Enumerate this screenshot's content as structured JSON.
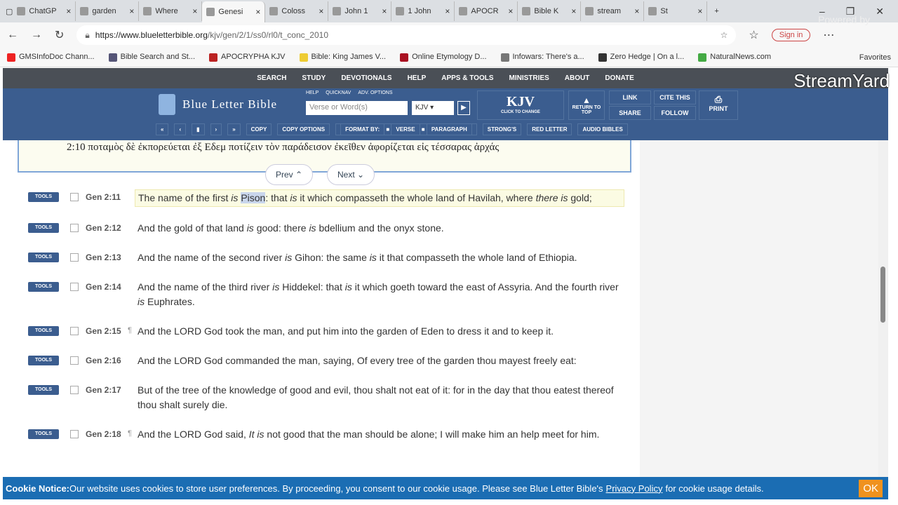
{
  "browser": {
    "tabs": [
      "ChatGP",
      "garden",
      "Where",
      "Genesi",
      "Coloss",
      "John 1",
      "1 John",
      "APOCR",
      "Bible K",
      "stream",
      "St"
    ],
    "active_tab": 3,
    "url_host": "https://www.blueletterbible.org",
    "url_path": "/kjv/gen/2/1/ss0/rl0/t_conc_2010",
    "sign_in": "Sign in",
    "bookmarks": [
      {
        "label": "GMSInfoDoc Chann...",
        "color": "#e22"
      },
      {
        "label": "Bible Search and St...",
        "color": "#557"
      },
      {
        "label": "APOCRYPHA KJV",
        "color": "#b22"
      },
      {
        "label": "Bible: King James V...",
        "color": "#ec3"
      },
      {
        "label": "Online Etymology D...",
        "color": "#a12"
      },
      {
        "label": "Infowars: There's a...",
        "color": "#777"
      },
      {
        "label": "Zero Hedge | On a l...",
        "color": "#333"
      },
      {
        "label": "NaturalNews.com",
        "color": "#4a4"
      }
    ],
    "favorites": "Favorites"
  },
  "overlay": {
    "powered_by": "Powered by",
    "brand": "StreamYard"
  },
  "site": {
    "nav": [
      "SEARCH",
      "STUDY",
      "DEVOTIONALS",
      "HELP",
      "APPS & TOOLS",
      "MINISTRIES",
      "ABOUT",
      "DONATE"
    ],
    "logo": "Blue Letter Bible",
    "search_links": [
      "HELP",
      "QUICKNAV",
      "ADV. OPTIONS"
    ],
    "search_placeholder": "Verse or Word(s)",
    "version_select": "KJV",
    "version_big": "KJV",
    "version_hint": "CLICK TO CHANGE",
    "return_top": "RETURN TO TOP",
    "link": "LINK",
    "share": "SHARE",
    "cite": "CITE THIS",
    "follow": "FOLLOW",
    "print": "PRINT",
    "toolbar": [
      "COPY",
      "COPY OPTIONS",
      "FORMAT BY:",
      "VERSE",
      "PARAGRAPH",
      "STRONG'S",
      "RED LETTER",
      "AUDIO BIBLES"
    ]
  },
  "greek_line": "2:10  ποταμὸς δὲ ἐκπορεύεται ἐξ Εδεμ ποτίζειν τὸν παράδεισον ἐκεῖθεν ἀφορίζεται εἰς τέσσαρας ἀρχάς",
  "prev": "Prev",
  "next": "Next",
  "tools_label": "TOOLS",
  "verses": [
    {
      "ref": "Gen 2:11",
      "pilcrow": false,
      "highlight": true,
      "segments": [
        [
          "The name of the first ",
          ""
        ],
        [
          "is",
          "i"
        ],
        [
          " ",
          ""
        ],
        [
          "Pison",
          "s"
        ],
        [
          ": that ",
          ""
        ],
        [
          "is",
          "i"
        ],
        [
          " it which compasseth the whole land of Havilah, where ",
          ""
        ],
        [
          "there is",
          "i"
        ],
        [
          " gold;",
          ""
        ]
      ]
    },
    {
      "ref": "Gen 2:12",
      "pilcrow": false,
      "segments": [
        [
          "And the gold of that land ",
          ""
        ],
        [
          "is",
          "i"
        ],
        [
          " good: there ",
          ""
        ],
        [
          "is",
          "i"
        ],
        [
          " bdellium and the onyx stone.",
          ""
        ]
      ]
    },
    {
      "ref": "Gen 2:13",
      "pilcrow": false,
      "segments": [
        [
          "And the name of the second river ",
          ""
        ],
        [
          "is",
          "i"
        ],
        [
          " Gihon: the same ",
          ""
        ],
        [
          "is",
          "i"
        ],
        [
          " it that compasseth the whole land of Ethiopia.",
          ""
        ]
      ]
    },
    {
      "ref": "Gen 2:14",
      "pilcrow": false,
      "segments": [
        [
          "And the name of the third river ",
          ""
        ],
        [
          "is",
          "i"
        ],
        [
          " Hiddekel: that ",
          ""
        ],
        [
          "is",
          "i"
        ],
        [
          " it which goeth toward the east of Assyria. And the fourth river ",
          ""
        ],
        [
          "is",
          "i"
        ],
        [
          " Euphrates.",
          ""
        ]
      ]
    },
    {
      "ref": "Gen 2:15",
      "pilcrow": true,
      "segments": [
        [
          "And the LORD God took the man, and put him into the garden of Eden to dress it and to keep it.",
          ""
        ]
      ]
    },
    {
      "ref": "Gen 2:16",
      "pilcrow": false,
      "segments": [
        [
          "And the LORD God commanded the man, saying, Of every tree of the garden thou mayest freely eat:",
          ""
        ]
      ]
    },
    {
      "ref": "Gen 2:17",
      "pilcrow": false,
      "segments": [
        [
          "But of the tree of the knowledge of good and evil, thou shalt not eat of it: for in the day that thou eatest thereof thou shalt surely die.",
          ""
        ]
      ]
    },
    {
      "ref": "Gen 2:18",
      "pilcrow": true,
      "segments": [
        [
          "And the LORD God said, ",
          ""
        ],
        [
          "It is",
          "i"
        ],
        [
          " not good that the man should be alone; I will make him an help meet for him.",
          ""
        ]
      ]
    }
  ],
  "cookie": {
    "title": "Cookie Notice:",
    "text": " Our website uses cookies to store user preferences. By proceeding, you consent to our cookie usage. Please see Blue Letter Bible's",
    "link": "Privacy Policy",
    "tail": "for cookie usage details.",
    "ok": "OK"
  }
}
